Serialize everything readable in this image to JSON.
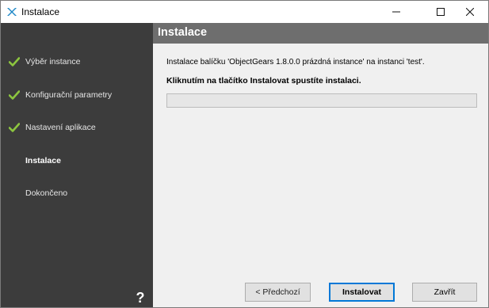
{
  "window": {
    "title": "Instalace"
  },
  "titlebar": {
    "minimize_glyph": "—",
    "maximize_glyph": "☐",
    "close_glyph": "✕"
  },
  "sidebar": {
    "items": [
      {
        "label": "Výběr instance",
        "state": "done"
      },
      {
        "label": "Konfigurační parametry",
        "state": "done"
      },
      {
        "label": "Nastavení aplikace",
        "state": "done"
      },
      {
        "label": "Instalace",
        "state": "active"
      },
      {
        "label": "Dokončeno",
        "state": "pending"
      }
    ],
    "help_glyph": "?"
  },
  "header": {
    "title": "Instalace"
  },
  "main": {
    "info_text": "Instalace balíčku 'ObjectGears 1.8.0.0 prázdná instance' na instanci 'test'.",
    "instruction_text": "Kliknutím na tlačítko Instalovat spustíte instalaci.",
    "progress": 0
  },
  "buttons": {
    "back_label": "< Předchozí",
    "install_label": "Instalovat",
    "close_label": "Zavřít"
  },
  "colors": {
    "sidebar_bg": "#3c3c3c",
    "header_bg": "#6e6e6e",
    "check_green": "#8dc63f",
    "accent_blue": "#0078d7"
  }
}
